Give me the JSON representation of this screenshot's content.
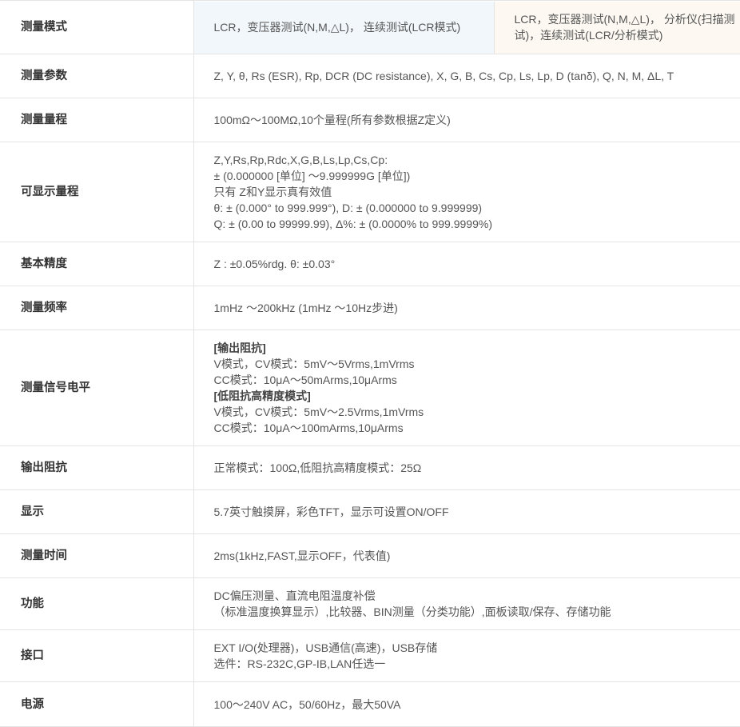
{
  "rows": [
    {
      "label": "测量模式",
      "height": 67,
      "split": true,
      "cells": [
        [
          "LCR，变压器测试(N,M,△L)， 连续测试(LCR模式)"
        ],
        [
          "LCR，变压器测试(N,M,△L)， 分析仪(扫描测",
          "试)，连续测试(LCR/分析模式)"
        ]
      ]
    },
    {
      "label": "测量参数",
      "height": 55,
      "lines": [
        "Z, Y, θ, Rs (ESR), Rp, DCR (DC resistance), X, G, B, Cs, Cp, Ls, Lp, D (tanδ), Q, N, M, ΔL, T"
      ]
    },
    {
      "label": "测量量程",
      "height": 55,
      "lines": [
        "100mΩ～100MΩ,10个量程(所有参数根据Z定义)"
      ]
    },
    {
      "label": "可显示量程",
      "height": 125,
      "lines": [
        "Z,Y,Rs,Rp,Rdc,X,G,B,Ls,Lp,Cs,Cp:",
        "± (0.000000 [单位] ～9.999999G [单位])",
        "只有 Z和Y显示真有效值",
        "θ: ± (0.000° to 999.999°), D: ± (0.000000 to 9.999999)",
        "Q: ± (0.00 to 99999.99), Δ%: ± (0.0000% to 999.9999%)"
      ]
    },
    {
      "label": "基本精度",
      "height": 55,
      "lines": [
        "Z : ±0.05%rdg. θ: ±0.03°"
      ]
    },
    {
      "label": "测量频率",
      "height": 55,
      "lines": [
        "1mHz ～200kHz (1mHz ～10Hz步进)"
      ]
    },
    {
      "label": "测量信号电平",
      "height": 145,
      "lines": [
        {
          "text": "[输出阻抗]",
          "bold": true
        },
        "V模式，CV模式：5mV～5Vrms,1mVrms",
        "CC模式：10μA～50mArms,10μArms",
        {
          "text": "[低阻抗高精度模式]",
          "bold": true
        },
        "V模式，CV模式：5mV～2.5Vrms,1mVrms",
        "CC模式：10μA～100mArms,10μArms"
      ]
    },
    {
      "label": "输出阻抗",
      "height": 55,
      "lines": [
        "正常模式：100Ω,低阻抗高精度模式：25Ω"
      ]
    },
    {
      "label": "显示",
      "height": 55,
      "lines": [
        "5.7英寸触摸屏，彩色TFT，显示可设置ON/OFF"
      ]
    },
    {
      "label": "测量时间",
      "height": 55,
      "lines": [
        "2ms(1kHz,FAST,显示OFF，代表值)"
      ]
    },
    {
      "label": "功能",
      "height": 65,
      "lines": [
        "DC偏压测量、直流电阻温度补偿",
        "（标准温度换算显示）,比较器、BIN测量（分类功能）,面板读取/保存、存储功能"
      ]
    },
    {
      "label": "接口",
      "height": 65,
      "lines": [
        "EXT I/O(处理器)，USB通信(高速)，USB存储",
        "选件：RS-232C,GP-IB,LAN任选一"
      ]
    },
    {
      "label": "电源",
      "height": 56,
      "lines": [
        "100～240V AC，50/60Hz，最大50VA"
      ]
    }
  ]
}
